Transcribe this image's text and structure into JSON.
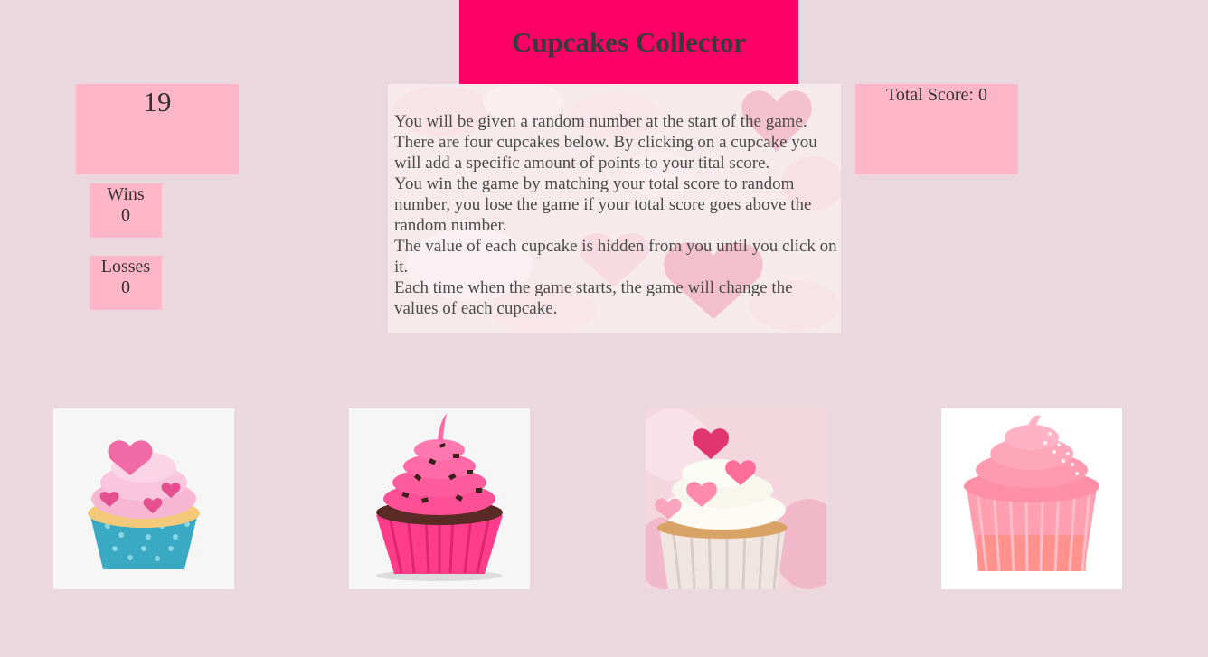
{
  "header": {
    "title": "Cupcakes Collector"
  },
  "random_number": "19",
  "stats": {
    "wins_label": "Wins",
    "wins_value": "0",
    "losses_label": "Losses",
    "losses_value": "0"
  },
  "total_score": {
    "text": "Total Score: 0"
  },
  "instructions": {
    "lines": [
      "You will be given a random number at the start of the game.",
      "There are four cupcakes below. By clicking on a cupcake you will add a specific amount of points to your tital score.",
      "You win the game by matching your total score to random number, you lose the game if your total score goes above the random number.",
      "The value of each cupcake is hidden from you until you click on it.",
      "Each time when the game starts, the game will change the values of each cupcake."
    ]
  },
  "cupcakes": [
    {
      "icon": "cupcake-blue-liner-pink-frosting-icon",
      "colors": {
        "liner": "#3aa9c4",
        "frosting": "#f7b6d2"
      }
    },
    {
      "icon": "cupcake-hot-pink-chocolate-chips-icon",
      "colors": {
        "liner": "#ff3d8b",
        "frosting": "#ff4f95"
      }
    },
    {
      "icon": "cupcake-white-frosting-hearts-icon",
      "colors": {
        "liner": "#efe6e2",
        "frosting": "#fbfbf4"
      }
    },
    {
      "icon": "cupcake-pink-frosting-sprinkles-icon",
      "colors": {
        "liner": "#ff9fb0",
        "frosting": "#ff8fa6"
      }
    }
  ],
  "colors": {
    "background": "#ead8de",
    "banner": "#ff0066",
    "panel": "#ffb6c8"
  }
}
